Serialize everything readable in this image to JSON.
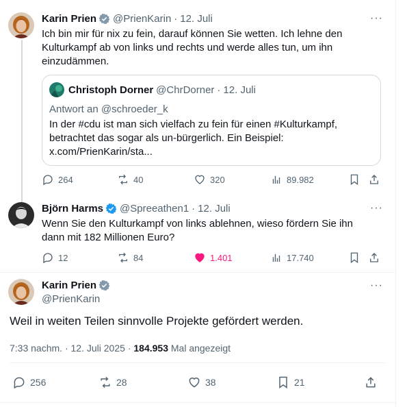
{
  "tweet1": {
    "name": "Karin Prien",
    "handle": "@PrienKarin",
    "sep": "·",
    "date": "12. Juli",
    "more": "···",
    "text": "Ich bin mir für nix zu fein, darauf können Sie wetten. Ich lehne den Kulturkampf ab von links und rechts und werde alles tun, um ihn einzudämmen.",
    "quote": {
      "name": "Christoph Dorner",
      "handle": "@ChrDorner",
      "sep": "·",
      "date": "12. Juli",
      "reply_to": "Antwort an @schroeder_k",
      "text_line1": "In der #cdu ist man sich vielfach zu fein für einen #Kulturkampf,",
      "text_line2": "betrachtet das sogar als un-bürgerlich. Ein Beispiel:",
      "text_line3": "x.com/PrienKarin/sta..."
    },
    "stats": {
      "replies": "264",
      "reposts": "40",
      "likes": "320",
      "views": "89.982"
    }
  },
  "tweet2": {
    "name": "Björn Harms",
    "handle": "@Spreeathen1",
    "sep": "·",
    "date": "12. Juli",
    "more": "···",
    "text": "Wenn Sie den Kulturkampf von links ablehnen, wieso fördern Sie ihn dann mit 182 Millionen Euro?",
    "stats": {
      "replies": "12",
      "reposts": "84",
      "likes": "1.401",
      "views": "17.740"
    }
  },
  "main": {
    "name": "Karin Prien",
    "handle": "@PrienKarin",
    "more": "···",
    "text": "Weil in weiten Teilen sinnvolle Projekte gefördert werden.",
    "time": "7:33 nachm.",
    "sep": "·",
    "date": "12. Juli 2025",
    "sep2": "·",
    "views": "184.953",
    "views_label": "Mal angezeigt",
    "stats": {
      "replies": "256",
      "reposts": "28",
      "likes": "38",
      "bookmarks": "21"
    }
  },
  "colors": {
    "accent": "#1d9bf0",
    "like_active": "#f91880",
    "muted": "#536471",
    "verified": "#829aab"
  }
}
